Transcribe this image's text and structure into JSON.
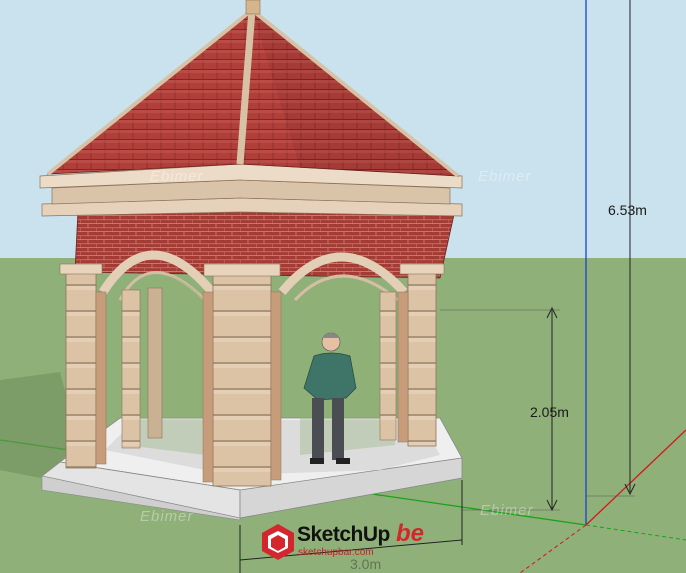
{
  "scene": {
    "title": "Gazebo model",
    "dimensions": {
      "total_height": "6.53m",
      "person_height": "2.05m",
      "base_width": "3.0m"
    },
    "watermark": "Ebimer"
  },
  "logo": {
    "brand": "SketchUp",
    "suffix": "be",
    "site": "sketchupbar.com"
  },
  "colors": {
    "sky": "#c9e2ee",
    "ground": "#8fb179",
    "roof": "#b1413c",
    "brick": "#a33a33",
    "stone": "#d9bfa3",
    "axis_blue": "#1d3fd2",
    "axis_green": "#1aa21a",
    "axis_red": "#d01a1a"
  }
}
